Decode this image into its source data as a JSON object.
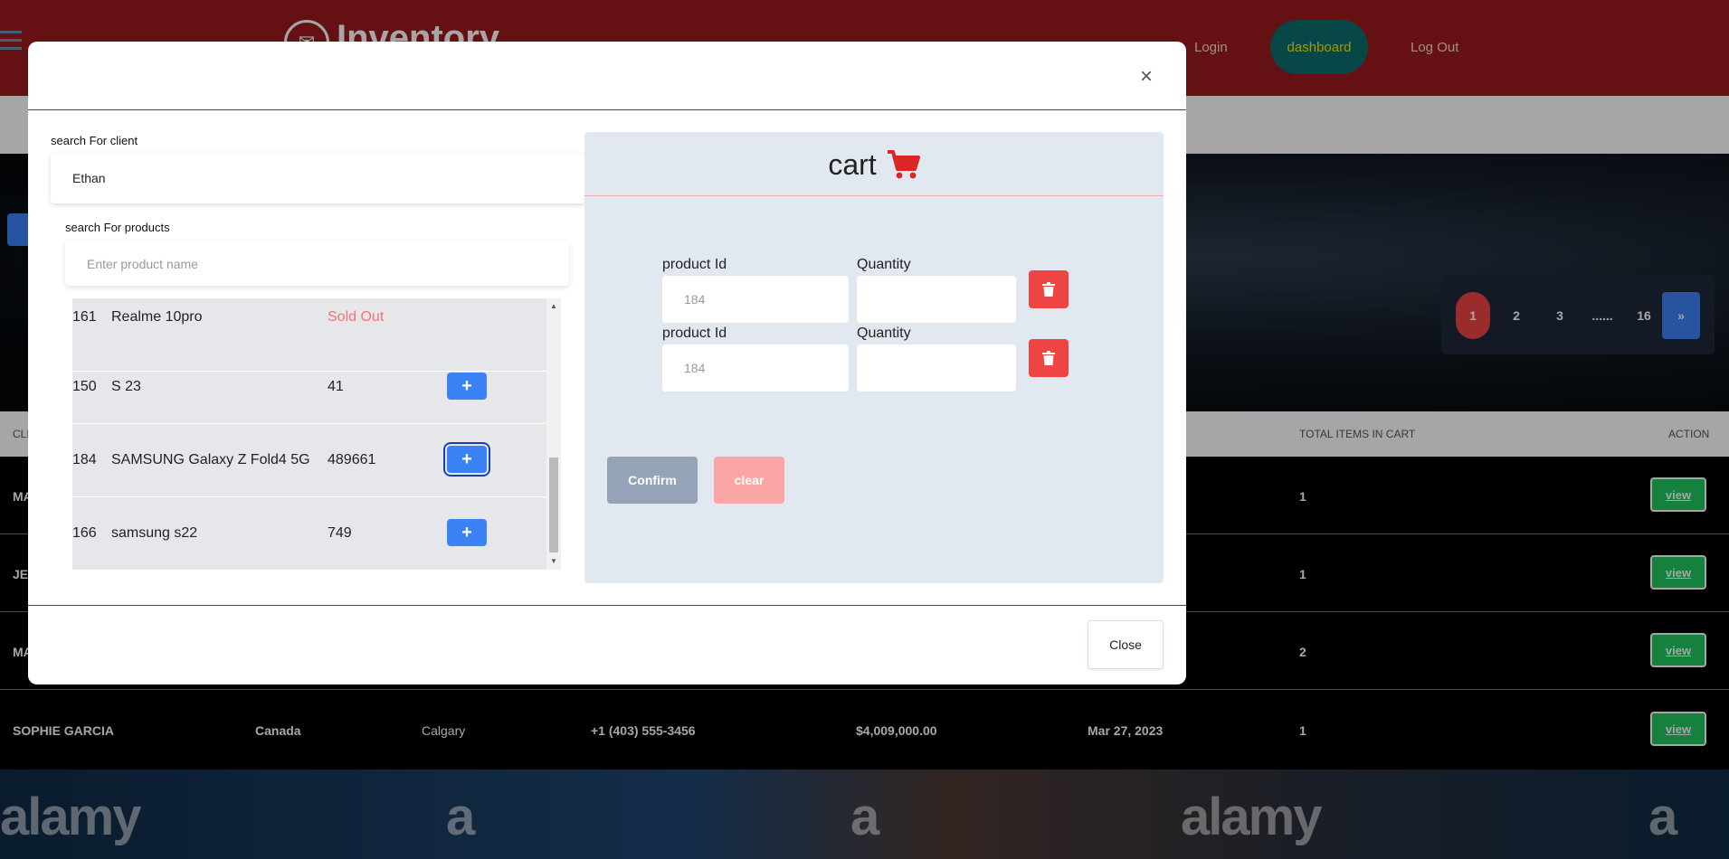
{
  "header": {
    "brand": "Inventory",
    "nav": {
      "login": "Login",
      "dashboard": "dashboard",
      "logout": "Log Out"
    }
  },
  "pagination": {
    "pages": [
      "1",
      "2",
      "3",
      "......",
      "16",
      "»"
    ],
    "active": "1"
  },
  "table": {
    "headers": {
      "client": "CLI",
      "total": "TOTAL ITEMS IN CART",
      "action": "ACTION"
    },
    "rows": [
      {
        "name": "MA",
        "total": "1",
        "action": "view"
      },
      {
        "name": "JES",
        "total": "1",
        "action": "view"
      },
      {
        "name": "MA",
        "total": "2",
        "action": "view"
      },
      {
        "name": "SOPHIE GARCIA",
        "country": "Canada",
        "city": "Calgary",
        "phone": "+1 (403) 555-3456",
        "amount": "$4,009,000.00",
        "date": "Mar 27, 2023",
        "total": "1",
        "action": "view"
      }
    ]
  },
  "watermark": {
    "a": "alamy",
    "b": "a",
    "c": "a",
    "d": "alamy",
    "e": "a"
  },
  "modal": {
    "close_x": "×",
    "client": {
      "label": "search For client",
      "value": "Ethan"
    },
    "products": {
      "label": "search For products",
      "placeholder": "Enter product name",
      "items": [
        {
          "id": "161",
          "name": "Realme 10pro",
          "qty": "Sold Out",
          "sold_out": true
        },
        {
          "id": "150",
          "name": "S 23",
          "qty": "41",
          "add": "+"
        },
        {
          "id": "184",
          "name": "SAMSUNG Galaxy Z Fold4 5G",
          "qty": "489661",
          "add": "+"
        },
        {
          "id": "166",
          "name": "samsung s22",
          "qty": "749",
          "add": "+"
        }
      ]
    },
    "cart": {
      "title": "cart",
      "lines": [
        {
          "id_label": "product Id",
          "id_placeholder": "184",
          "qty_label": "Quantity",
          "qty_value": ""
        },
        {
          "id_label": "product Id",
          "id_placeholder": "184",
          "qty_label": "Quantity",
          "qty_value": ""
        }
      ],
      "confirm": "Confirm",
      "clear": "clear"
    },
    "close_button": "Close"
  },
  "colors": {
    "topbar": "#9b1b1e",
    "dashboard": "#0d6e6e",
    "primary": "#3b82f6",
    "danger": "#ef4444",
    "success": "#22c55e"
  }
}
